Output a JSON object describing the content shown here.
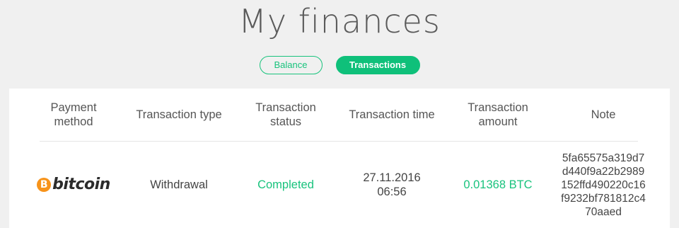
{
  "page": {
    "title": "My finances"
  },
  "tabs": {
    "balance": "Balance",
    "transactions": "Transactions",
    "active": "transactions"
  },
  "colors": {
    "accent": "#19c37d",
    "bitcoin": "#f7931a"
  },
  "table": {
    "headers": {
      "payment_method": "Payment method",
      "transaction_type": "Transaction type",
      "transaction_status": "Transaction status",
      "transaction_time": "Transaction time",
      "transaction_amount": "Transaction amount",
      "note": "Note"
    },
    "rows": [
      {
        "payment_method": {
          "icon": "bitcoin-icon",
          "icon_glyph": "B",
          "label": "bitcoin"
        },
        "transaction_type": "Withdrawal",
        "transaction_status": "Completed",
        "transaction_time": "27.11.2016 06:56",
        "transaction_amount": "0.01368 BTC",
        "note": "5fa65575a319d7d440f9a22b2989152ffd490220c16f9232bf781812c470aaed"
      }
    ]
  }
}
